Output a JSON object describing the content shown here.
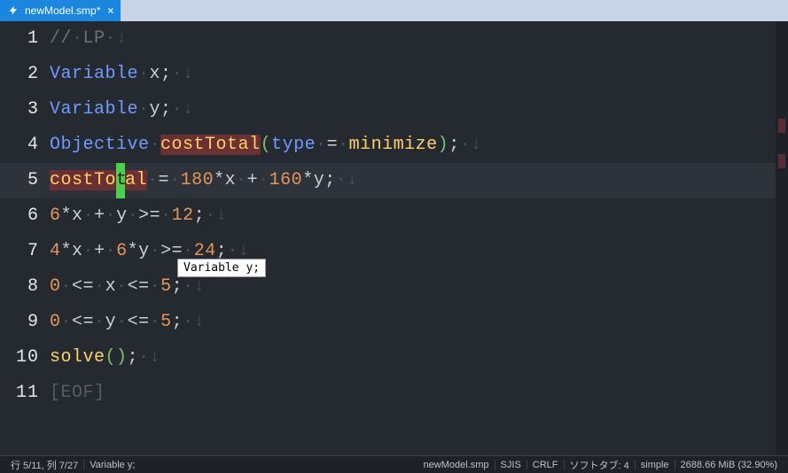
{
  "tab": {
    "title": "newModel.smp*",
    "close_glyph": "×"
  },
  "tooltip": "Variable y;",
  "code_tokens": [
    [
      {
        "t": "//",
        "c": "comment"
      },
      {
        "t": "·",
        "c": "dot"
      },
      {
        "t": "LP",
        "c": "comment"
      },
      {
        "t": "·",
        "c": "dot"
      },
      {
        "t": "↓",
        "c": "eol"
      }
    ],
    [
      {
        "t": "Variable",
        "c": "key"
      },
      {
        "t": "·",
        "c": "dot"
      },
      {
        "t": "x",
        "c": "plain"
      },
      {
        "t": ";",
        "c": "plain"
      },
      {
        "t": "·",
        "c": "dot"
      },
      {
        "t": "↓",
        "c": "eol"
      }
    ],
    [
      {
        "t": "Variable",
        "c": "key"
      },
      {
        "t": "·",
        "c": "dot"
      },
      {
        "t": "y",
        "c": "plain"
      },
      {
        "t": ";",
        "c": "plain"
      },
      {
        "t": "·",
        "c": "dot"
      },
      {
        "t": "↓",
        "c": "eol"
      }
    ],
    [
      {
        "t": "Objective",
        "c": "key"
      },
      {
        "t": "·",
        "c": "dot"
      },
      {
        "t": "costTotal",
        "c": "func",
        "hl": true
      },
      {
        "t": "(",
        "c": "str"
      },
      {
        "t": "type",
        "c": "key"
      },
      {
        "t": "·",
        "c": "dot"
      },
      {
        "t": "=",
        "c": "plain"
      },
      {
        "t": "·",
        "c": "dot"
      },
      {
        "t": "minimize",
        "c": "func"
      },
      {
        "t": ")",
        "c": "str"
      },
      {
        "t": ";",
        "c": "plain"
      },
      {
        "t": "·",
        "c": "dot"
      },
      {
        "t": "↓",
        "c": "eol"
      }
    ],
    [
      {
        "t": "costTo",
        "c": "func",
        "hl": true
      },
      {
        "t": "t",
        "c": "func",
        "cursor": true
      },
      {
        "t": "al",
        "c": "func",
        "hl": true
      },
      {
        "t": "·",
        "c": "dot"
      },
      {
        "t": "=",
        "c": "plain"
      },
      {
        "t": "·",
        "c": "dot"
      },
      {
        "t": "180",
        "c": "num"
      },
      {
        "t": "*",
        "c": "plain"
      },
      {
        "t": "x",
        "c": "plain"
      },
      {
        "t": "·",
        "c": "dot"
      },
      {
        "t": "+",
        "c": "plain"
      },
      {
        "t": "·",
        "c": "dot"
      },
      {
        "t": "160",
        "c": "num"
      },
      {
        "t": "*",
        "c": "plain"
      },
      {
        "t": "y",
        "c": "plain"
      },
      {
        "t": ";",
        "c": "plain"
      },
      {
        "t": "·",
        "c": "dot"
      },
      {
        "t": "↓",
        "c": "eol"
      }
    ],
    [
      {
        "t": "6",
        "c": "num"
      },
      {
        "t": "*",
        "c": "plain"
      },
      {
        "t": "x",
        "c": "plain"
      },
      {
        "t": "·",
        "c": "dot"
      },
      {
        "t": "+",
        "c": "plain"
      },
      {
        "t": "·",
        "c": "dot"
      },
      {
        "t": "y",
        "c": "plain"
      },
      {
        "t": "·",
        "c": "dot"
      },
      {
        "t": ">=",
        "c": "plain"
      },
      {
        "t": "·",
        "c": "dot"
      },
      {
        "t": "12",
        "c": "num"
      },
      {
        "t": ";",
        "c": "plain"
      },
      {
        "t": "·",
        "c": "dot"
      },
      {
        "t": "↓",
        "c": "eol"
      }
    ],
    [
      {
        "t": "4",
        "c": "num"
      },
      {
        "t": "*",
        "c": "plain"
      },
      {
        "t": "x",
        "c": "plain"
      },
      {
        "t": "·",
        "c": "dot"
      },
      {
        "t": "+",
        "c": "plain"
      },
      {
        "t": "·",
        "c": "dot"
      },
      {
        "t": "6",
        "c": "num"
      },
      {
        "t": "*",
        "c": "plain"
      },
      {
        "t": "y",
        "c": "plain"
      },
      {
        "t": "·",
        "c": "dot"
      },
      {
        "t": ">=",
        "c": "plain"
      },
      {
        "t": "·",
        "c": "dot"
      },
      {
        "t": "24",
        "c": "num"
      },
      {
        "t": ";",
        "c": "plain"
      },
      {
        "t": "·",
        "c": "dot"
      },
      {
        "t": "↓",
        "c": "eol"
      }
    ],
    [
      {
        "t": "0",
        "c": "num"
      },
      {
        "t": "·",
        "c": "dot"
      },
      {
        "t": "<=",
        "c": "plain"
      },
      {
        "t": "·",
        "c": "dot"
      },
      {
        "t": "x",
        "c": "plain"
      },
      {
        "t": "·",
        "c": "dot"
      },
      {
        "t": "<=",
        "c": "plain"
      },
      {
        "t": "·",
        "c": "dot"
      },
      {
        "t": "5",
        "c": "num"
      },
      {
        "t": ";",
        "c": "plain"
      },
      {
        "t": "·",
        "c": "dot"
      },
      {
        "t": "↓",
        "c": "eol"
      }
    ],
    [
      {
        "t": "0",
        "c": "num"
      },
      {
        "t": "·",
        "c": "dot"
      },
      {
        "t": "<=",
        "c": "plain"
      },
      {
        "t": "·",
        "c": "dot"
      },
      {
        "t": "y",
        "c": "plain"
      },
      {
        "t": "·",
        "c": "dot"
      },
      {
        "t": "<=",
        "c": "plain"
      },
      {
        "t": "·",
        "c": "dot"
      },
      {
        "t": "5",
        "c": "num"
      },
      {
        "t": ";",
        "c": "plain"
      },
      {
        "t": "·",
        "c": "dot"
      },
      {
        "t": "↓",
        "c": "eol"
      }
    ],
    [
      {
        "t": "solve",
        "c": "func"
      },
      {
        "t": "()",
        "c": "str"
      },
      {
        "t": ";",
        "c": "plain"
      },
      {
        "t": "·",
        "c": "dot"
      },
      {
        "t": "↓",
        "c": "eol"
      }
    ],
    [
      {
        "t": "[EOF]",
        "c": "eof"
      }
    ]
  ],
  "active_line_index": 4,
  "status": {
    "pos": "行 5/11, 列 7/27",
    "selinfo": "Variable y;",
    "filename": "newModel.smp",
    "encoding": "SJIS",
    "eol_mode": "CRLF",
    "softtab": "ソフトタブ: 4",
    "mode": "simple",
    "mem": "2688.66 MiB (32.90%)"
  }
}
